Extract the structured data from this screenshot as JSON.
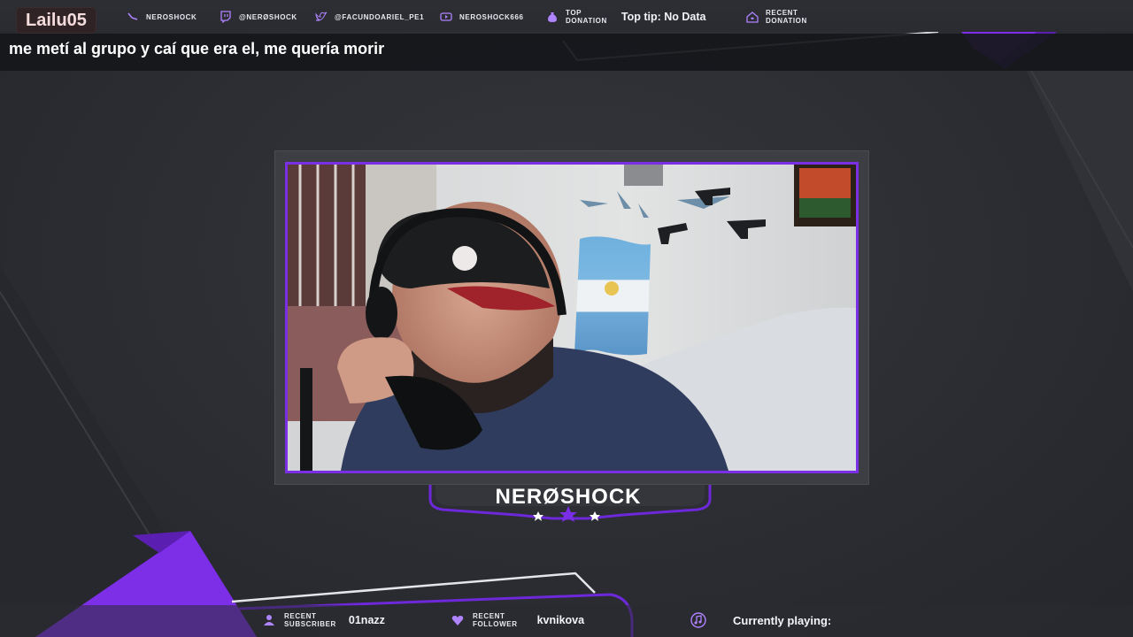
{
  "chat": {
    "username": "Lailu05",
    "message": "me metí al grupo y caí que era el, me quería morir"
  },
  "socials": {
    "kick": "NEROSHOCK",
    "twitch": "@NERØSHOCK",
    "twitter": "@FACUNDOARIEL_PE1",
    "youtube": "NEROSHOCK666"
  },
  "top_donation": {
    "label_line1": "TOP",
    "label_line2": "DONATION",
    "value": "Top tip: No Data"
  },
  "recent_donation": {
    "label_line1": "RECENT",
    "label_line2": "DONATION"
  },
  "streamer_name": "NERØSHOCK",
  "bottom": {
    "subscriber_label_line1": "RECENT",
    "subscriber_label_line2": "SUBSCRIBER",
    "subscriber_value": "01nazz",
    "follower_label_line1": "RECENT",
    "follower_label_line2": "FOLLOWER",
    "follower_value": "kvnikova",
    "now_playing_label": "Currently playing:"
  },
  "colors": {
    "accent": "#7a2ee6",
    "background": "#2b2d33"
  }
}
